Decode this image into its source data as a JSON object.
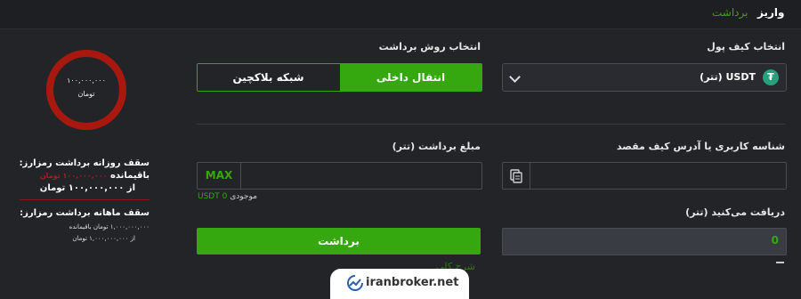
{
  "tabs": {
    "deposit": "واریز",
    "withdraw": "برداشت"
  },
  "wallet": {
    "label": "انتخاب کیف پول",
    "selected": "USDT (تتر)",
    "coin_icon": "tether-icon"
  },
  "method": {
    "label": "انتخاب روش برداشت",
    "internal": "انتقال داخلی",
    "blockchain": "شبکه بلاکچین"
  },
  "address": {
    "label": "شناسه کاربری یا آدرس کیف مقصد",
    "value": ""
  },
  "amount": {
    "label": "مبلغ برداشت (تتر)",
    "max": "MAX",
    "value": "",
    "balance_label": "موجودی",
    "balance_value": "0 USDT"
  },
  "receive": {
    "label": "دریافت می‌کنید (تتر)",
    "value": "0"
  },
  "submit_label": "برداشت",
  "faint_link": "شرح کلی",
  "limits": {
    "ring_amount": "۱۰۰,۰۰۰,۰۰۰",
    "ring_unit": "تومان",
    "ring_fraction_used": 0,
    "ring_color": "#a8180f",
    "daily_title": "سقف روزانه برداشت رمزارز:",
    "daily_remaining_amount": "۱۰۰,۰۰۰,۰۰۰ تومان",
    "daily_remaining_label": "باقیمانده",
    "daily_total": "از ۱۰۰,۰۰۰,۰۰۰ تومان",
    "monthly_title": "سقف ماهانه برداشت رمزارز:",
    "monthly_remaining": "۱,۰۰۰,۰۰۰,۰۰۰ تومان باقیمانده",
    "monthly_total": "از ۱,۰۰۰,۰۰۰,۰۰۰ تومان"
  },
  "watermark": "iranbroker.net",
  "colors": {
    "accent": "#36a80f",
    "background": "#232428",
    "danger": "#a8180f"
  }
}
